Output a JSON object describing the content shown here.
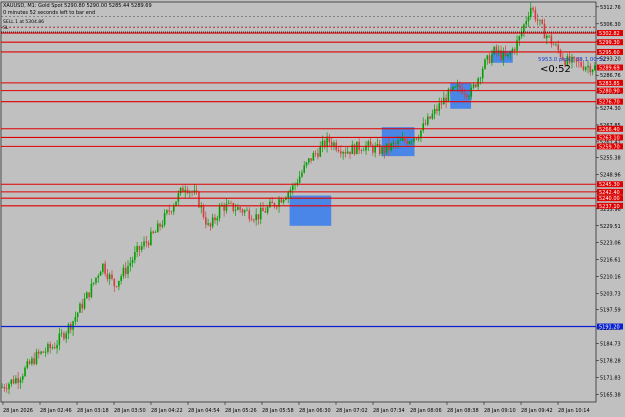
{
  "window": {
    "symbol_line": "XAUUSD, M1: Gold Spot 5290.80 5290.00 5285.44 5289.69",
    "timer_line": "0 minutes 52 seconds left to bar end"
  },
  "trade": {
    "sell_label": "SELL 1 at 5304.86",
    "sl_label": "SL",
    "pips_label": "5953.0 pips | 38.1 00:52",
    "countdown": "<0:52"
  },
  "colors": {
    "background": "#c0c0c0",
    "candle_up": "#00a000",
    "candle_down": "#d04040",
    "level_line": "#e00000",
    "zone": "#4a86e8",
    "blue_line": "#0a20d0",
    "grid_text": "#000000"
  },
  "chart_data": {
    "type": "candlestick",
    "symbol": "XAUUSD",
    "timeframe": "M1",
    "y_ticks": [
      "5312.76",
      "5306.30",
      "5299.65",
      "5293.20",
      "5286.76",
      "5280.31",
      "5274.30",
      "5267.85",
      "5261.41",
      "5255.38",
      "5248.96",
      "5242.51",
      "5235.96",
      "5229.51",
      "5223.06",
      "5216.61",
      "5210.16",
      "5203.73",
      "5197.59",
      "5190.66",
      "5184.73",
      "5178.28",
      "5171.83",
      "5165.38"
    ],
    "y_range": [
      5162.5,
      5314.6
    ],
    "x_ticks": [
      "28 Jan 2026",
      "28 Jan 02:46",
      "28 Jan 03:18",
      "28 Jan 03:50",
      "28 Jan 04:22",
      "28 Jan 04:54",
      "28 Jan 05:26",
      "28 Jan 05:58",
      "28 Jan 06:30",
      "28 Jan 07:02",
      "28 Jan 07:34",
      "28 Jan 08:06",
      "28 Jan 08:38",
      "28 Jan 09:10",
      "28 Jan 09:42",
      "28 Jan 10:14"
    ],
    "red_levels": [
      {
        "price": 5302.8,
        "label": "5302.82"
      },
      {
        "price": 5299.3,
        "label": "5299.30"
      },
      {
        "price": 5295.6,
        "label": "5295.60"
      },
      {
        "price": 5283.85,
        "label": "5283.85"
      },
      {
        "price": 5280.9,
        "label": "5280.90"
      },
      {
        "price": 5276.7,
        "label": "5276.70"
      },
      {
        "price": 5266.4,
        "label": "5266.40"
      },
      {
        "price": 5263.1,
        "label": "5263.10"
      },
      {
        "price": 5259.7,
        "label": "5259.70"
      },
      {
        "price": 5245.3,
        "label": "5245.30"
      },
      {
        "price": 5242.4,
        "label": "5242.40"
      },
      {
        "price": 5240.0,
        "label": "5240.00"
      },
      {
        "price": 5237.1,
        "label": "5237.10"
      }
    ],
    "blue_level": {
      "price": 5191.2,
      "label": "5191.20"
    },
    "dashed_levels": [
      {
        "price": 5309.0,
        "color": "#606060"
      },
      {
        "price": 5305.1,
        "color": "#606060"
      },
      {
        "price": 5304.9,
        "color": "#e00000"
      }
    ],
    "price_marker": {
      "price": 5289.69,
      "label": "5289.69"
    },
    "price_path": [
      [
        0,
        5168
      ],
      [
        0.03,
        5172
      ],
      [
        0.06,
        5180
      ],
      [
        0.09,
        5184
      ],
      [
        0.12,
        5193
      ],
      [
        0.15,
        5205
      ],
      [
        0.17,
        5215
      ],
      [
        0.19,
        5207
      ],
      [
        0.21,
        5213
      ],
      [
        0.23,
        5220
      ],
      [
        0.26,
        5227
      ],
      [
        0.29,
        5238
      ],
      [
        0.31,
        5245
      ],
      [
        0.33,
        5240
      ],
      [
        0.35,
        5228
      ],
      [
        0.37,
        5237
      ],
      [
        0.4,
        5236
      ],
      [
        0.43,
        5233
      ],
      [
        0.46,
        5238
      ],
      [
        0.49,
        5244
      ],
      [
        0.52,
        5255
      ],
      [
        0.55,
        5262
      ],
      [
        0.58,
        5258
      ],
      [
        0.61,
        5260
      ],
      [
        0.64,
        5258
      ],
      [
        0.67,
        5261
      ],
      [
        0.7,
        5264
      ],
      [
        0.72,
        5270
      ],
      [
        0.75,
        5279
      ],
      [
        0.77,
        5282
      ],
      [
        0.79,
        5280
      ],
      [
        0.81,
        5290
      ],
      [
        0.83,
        5296
      ],
      [
        0.85,
        5293
      ],
      [
        0.87,
        5300
      ],
      [
        0.89,
        5313
      ],
      [
        0.91,
        5304
      ],
      [
        0.93,
        5298
      ],
      [
        0.95,
        5292
      ],
      [
        0.97,
        5291
      ],
      [
        1.0,
        5289.7
      ]
    ],
    "zones": [
      {
        "x_from": 0.485,
        "x_to": 0.555,
        "y_from": 5229.5,
        "y_to": 5241.0
      },
      {
        "x_from": 0.64,
        "x_to": 0.695,
        "y_from": 5256.0,
        "y_to": 5267.0
      },
      {
        "x_from": 0.755,
        "x_to": 0.79,
        "y_from": 5274.0,
        "y_to": 5284.0
      },
      {
        "x_from": 0.825,
        "x_to": 0.86,
        "y_from": 5291.5,
        "y_to": 5296.0
      }
    ]
  }
}
